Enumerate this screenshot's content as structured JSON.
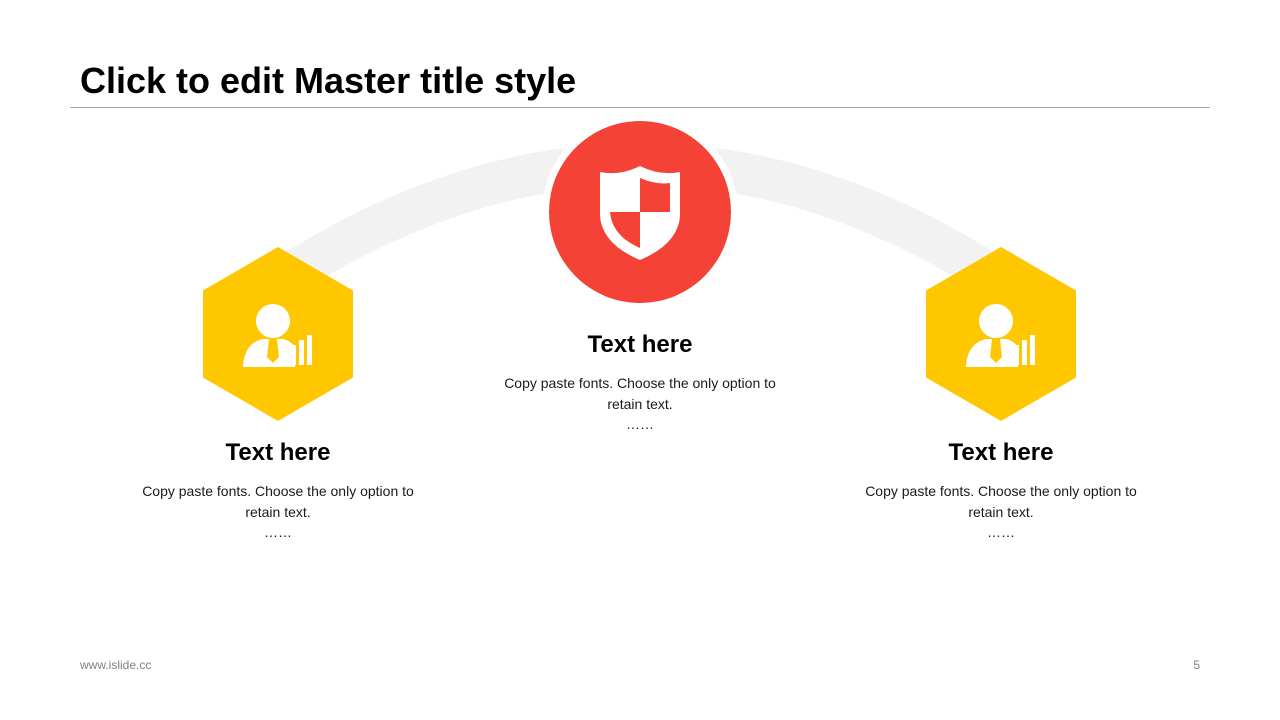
{
  "slide": {
    "title": "Click to edit Master title style",
    "footer_url": "www.islide.cc",
    "page_number": "5"
  },
  "colors": {
    "accent_yellow": "#FFC700",
    "accent_red": "#F44336",
    "arc_gray": "#F2F2F2",
    "rule_gray": "#A6A6A6"
  },
  "items": [
    {
      "icon": "businessman-chart-icon",
      "shape": "hexagon",
      "color": "#FFC700",
      "heading": "Text here",
      "body": "Copy paste fonts. Choose the only option to retain text.",
      "ellipsis": "……"
    },
    {
      "icon": "shield-icon",
      "shape": "circle",
      "color": "#F44336",
      "heading": "Text here",
      "body": "Copy paste fonts. Choose the only option to retain text.",
      "ellipsis": "……"
    },
    {
      "icon": "businessman-chart-icon",
      "shape": "hexagon",
      "color": "#FFC700",
      "heading": "Text here",
      "body": "Copy paste fonts. Choose the only option to retain text.",
      "ellipsis": "……"
    }
  ]
}
